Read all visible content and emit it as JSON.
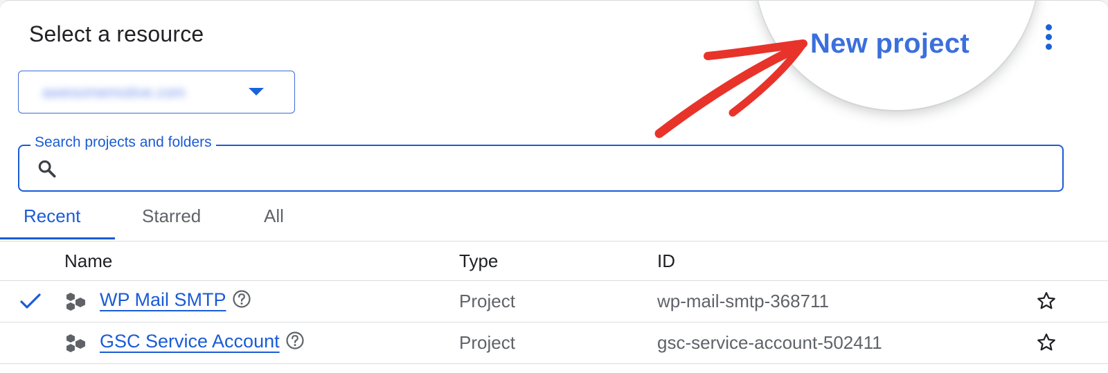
{
  "dialog": {
    "title": "Select a resource",
    "org_selector": {
      "value": "awesomemotive.com",
      "caret_icon": "caret-down-icon"
    },
    "new_project_label": "New project",
    "more_icon": "more-vert-icon",
    "search": {
      "label": "Search projects and folders",
      "value": "",
      "icon": "search-icon"
    },
    "tabs": [
      {
        "label": "Recent",
        "active": true
      },
      {
        "label": "Starred",
        "active": false
      },
      {
        "label": "All",
        "active": false
      }
    ],
    "table": {
      "columns": [
        "Name",
        "Type",
        "ID"
      ],
      "rows": [
        {
          "selected": true,
          "name": "WP Mail SMTP",
          "type": "Project",
          "id": "wp-mail-smtp-368711",
          "starred": false
        },
        {
          "selected": false,
          "name": "GSC Service Account",
          "type": "Project",
          "id": "gsc-service-account-502411",
          "starred": false
        }
      ]
    }
  },
  "colors": {
    "accent": "#1a5bd6",
    "annotation_arrow": "#e8332a",
    "text_primary": "#202124",
    "text_secondary": "#5f6368"
  }
}
